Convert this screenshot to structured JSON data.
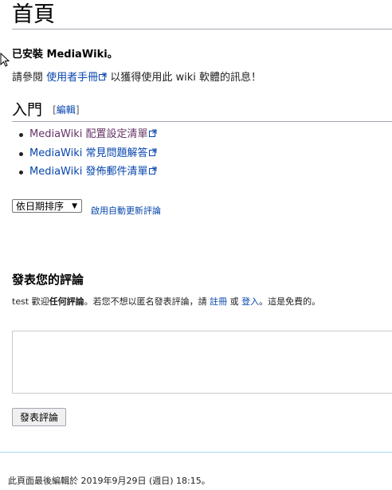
{
  "page": {
    "title": "首頁"
  },
  "content": {
    "installed": "已安裝 MediaWiki。",
    "consult_prefix": "請參閱",
    "consult_link": "使用者手冊",
    "consult_suffix": "以獲得使用此 wiki 軟體的訊息！"
  },
  "section": {
    "heading": "入門",
    "edit_open": "[",
    "edit_label": "編輯",
    "edit_close": "]",
    "links": [
      {
        "label": "MediaWiki 配置設定清單",
        "visited": true
      },
      {
        "label": "MediaWiki 常見問題解答",
        "visited": false
      },
      {
        "label": "MediaWiki 發佈郵件清單",
        "visited": false
      }
    ]
  },
  "comments": {
    "sort_value": "依日期排序",
    "auto_refresh": "啟用自動更新評論",
    "post_heading": "發表您的評論",
    "welcome_user": "test",
    "welcome_text1": "歡迎",
    "welcome_bold": "任何評論",
    "welcome_text2": "。若您不想以匿名發表評論，請",
    "register_link": "註冊",
    "welcome_or": "或",
    "login_link": "登入",
    "welcome_text3": "。這是免費的。",
    "submit_label": "發表評論"
  },
  "footer": {
    "last_edited": "此頁面最後編輯於 2019年9月29日 (週日) 18:15。"
  },
  "colors": {
    "link": "#0645ad",
    "visited": "#663366",
    "text": "#222222"
  },
  "icons": {
    "external": "external-link-icon",
    "cursor": "mouse-cursor-icon"
  }
}
